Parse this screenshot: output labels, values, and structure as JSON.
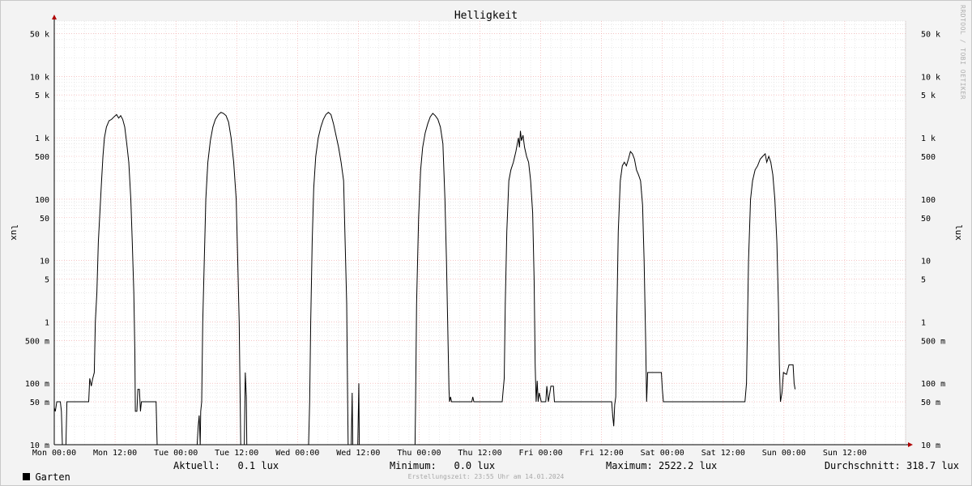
{
  "watermark": "RRDTOOL / TOBI OETIKER",
  "footer": "Erstellungszeit: 23:55 Uhr am 14.01.2024",
  "legend": {
    "series_name": "Garten",
    "current": "Aktuell:   0.1 lux",
    "minimum": "Minimum:   0.0 lux",
    "maximum": "Maximum: 2522.2 lux",
    "average": "Durchschnitt: 318.7 lux"
  },
  "colors": {
    "line": "#000000",
    "grid_minor": "#dcdcdc",
    "grid_major": "#f0a0a0",
    "axis": "#000000",
    "arrow": "#b00000",
    "canvas": "#ffffff",
    "background": "#f3f3f3"
  },
  "chart_data": {
    "type": "line",
    "title": "Helligkeit",
    "ylabel": "lux",
    "yscale": "log",
    "ylim": [
      10,
      100000
    ],
    "xlim": [
      0,
      168
    ],
    "x_unit": "hours since Mon 00:00",
    "x_ticks": [
      {
        "x": 0,
        "label": "Mon 00:00"
      },
      {
        "x": 12,
        "label": "Mon 12:00"
      },
      {
        "x": 24,
        "label": "Tue 00:00"
      },
      {
        "x": 36,
        "label": "Tue 12:00"
      },
      {
        "x": 48,
        "label": "Wed 00:00"
      },
      {
        "x": 60,
        "label": "Wed 12:00"
      },
      {
        "x": 72,
        "label": "Thu 00:00"
      },
      {
        "x": 84,
        "label": "Thu 12:00"
      },
      {
        "x": 96,
        "label": "Fri 00:00"
      },
      {
        "x": 108,
        "label": "Fri 12:00"
      },
      {
        "x": 120,
        "label": "Sat 00:00"
      },
      {
        "x": 132,
        "label": "Sat 12:00"
      },
      {
        "x": 144,
        "label": "Sun 00:00"
      },
      {
        "x": 156,
        "label": "Sun 12:00"
      }
    ],
    "y_ticks": [
      {
        "v": 10,
        "label": "10 m"
      },
      {
        "v": 50,
        "label": "50 m"
      },
      {
        "v": 100,
        "label": "100 m"
      },
      {
        "v": 500,
        "label": "500 m"
      },
      {
        "v": 1000,
        "label": "1"
      },
      {
        "v": 5000,
        "label": "5"
      },
      {
        "v": 10000,
        "label": "10"
      },
      {
        "v": 50000,
        "label": "50"
      },
      {
        "v": 100000,
        "label": "100"
      },
      {
        "v": 500000,
        "label": "500"
      },
      {
        "v": 1000000,
        "label": "1 k"
      },
      {
        "v": 5000000,
        "label": "5 k"
      },
      {
        "v": 10000000,
        "label": "10 k"
      },
      {
        "v": 50000000,
        "label": "50 k"
      }
    ],
    "y_tick_unit_note": "tick values in milli-lux",
    "series": [
      {
        "name": "Garten",
        "values": [
          [
            0,
            40
          ],
          [
            0.2,
            35
          ],
          [
            0.5,
            50
          ],
          [
            1.2,
            50
          ],
          [
            1.4,
            35
          ],
          [
            1.6,
            10
          ],
          [
            2.3,
            10
          ],
          [
            2.5,
            50
          ],
          [
            6.8,
            50
          ],
          [
            7.0,
            120
          ],
          [
            7.3,
            90
          ],
          [
            7.6,
            120
          ],
          [
            7.9,
            150
          ],
          [
            8.1,
            1000
          ],
          [
            8.4,
            3000
          ],
          [
            8.7,
            20000
          ],
          [
            9.0,
            60000
          ],
          [
            9.3,
            180000
          ],
          [
            9.6,
            500000
          ],
          [
            9.9,
            1000000
          ],
          [
            10.3,
            1500000
          ],
          [
            10.8,
            1900000
          ],
          [
            11.3,
            2000000
          ],
          [
            11.8,
            2200000
          ],
          [
            12.3,
            2400000
          ],
          [
            12.7,
            2100000
          ],
          [
            13.1,
            2300000
          ],
          [
            13.5,
            2000000
          ],
          [
            13.9,
            1500000
          ],
          [
            14.3,
            800000
          ],
          [
            14.7,
            400000
          ],
          [
            15.1,
            100000
          ],
          [
            15.4,
            20000
          ],
          [
            15.7,
            3000
          ],
          [
            15.9,
            300
          ],
          [
            16.0,
            35
          ],
          [
            16.3,
            35
          ],
          [
            16.5,
            80
          ],
          [
            16.8,
            80
          ],
          [
            17.0,
            35
          ],
          [
            17.2,
            50
          ],
          [
            20.1,
            50
          ],
          [
            20.3,
            10
          ],
          [
            28.2,
            10
          ],
          [
            28.4,
            20
          ],
          [
            28.6,
            30
          ],
          [
            28.8,
            10
          ],
          [
            28.9,
            35
          ],
          [
            29.1,
            50
          ],
          [
            29.3,
            1000
          ],
          [
            29.6,
            10000
          ],
          [
            29.9,
            100000
          ],
          [
            30.3,
            400000
          ],
          [
            30.8,
            900000
          ],
          [
            31.3,
            1500000
          ],
          [
            31.8,
            2000000
          ],
          [
            32.4,
            2400000
          ],
          [
            32.9,
            2600000
          ],
          [
            33.4,
            2500000
          ],
          [
            33.9,
            2300000
          ],
          [
            34.4,
            1800000
          ],
          [
            34.9,
            1000000
          ],
          [
            35.4,
            400000
          ],
          [
            35.9,
            100000
          ],
          [
            36.2,
            10000
          ],
          [
            36.5,
            1000
          ],
          [
            36.8,
            10
          ],
          [
            37.5,
            10
          ],
          [
            37.7,
            150
          ],
          [
            37.9,
            60
          ],
          [
            38.0,
            10
          ],
          [
            50.2,
            10
          ],
          [
            50.4,
            50
          ],
          [
            50.6,
            1000
          ],
          [
            50.9,
            20000
          ],
          [
            51.2,
            150000
          ],
          [
            51.6,
            500000
          ],
          [
            52.1,
            1000000
          ],
          [
            52.6,
            1500000
          ],
          [
            53.1,
            2000000
          ],
          [
            53.6,
            2400000
          ],
          [
            54.1,
            2600000
          ],
          [
            54.6,
            2400000
          ],
          [
            55.1,
            1700000
          ],
          [
            55.6,
            1100000
          ],
          [
            56.1,
            700000
          ],
          [
            56.6,
            400000
          ],
          [
            57.1,
            200000
          ],
          [
            57.4,
            20000
          ],
          [
            57.7,
            2000
          ],
          [
            57.9,
            50
          ],
          [
            58.0,
            10
          ],
          [
            58.6,
            10
          ],
          [
            58.8,
            70
          ],
          [
            58.9,
            10
          ],
          [
            59.9,
            10
          ],
          [
            60.1,
            100
          ],
          [
            60.2,
            10
          ],
          [
            71.2,
            10
          ],
          [
            71.3,
            40
          ],
          [
            71.5,
            2000
          ],
          [
            71.9,
            50000
          ],
          [
            72.3,
            300000
          ],
          [
            72.7,
            700000
          ],
          [
            73.2,
            1200000
          ],
          [
            73.7,
            1700000
          ],
          [
            74.2,
            2200000
          ],
          [
            74.7,
            2500000
          ],
          [
            75.2,
            2300000
          ],
          [
            75.7,
            2000000
          ],
          [
            76.2,
            1500000
          ],
          [
            76.7,
            800000
          ],
          [
            77.1,
            100000
          ],
          [
            77.4,
            10000
          ],
          [
            77.7,
            500
          ],
          [
            77.9,
            80
          ],
          [
            78.0,
            50
          ],
          [
            78.2,
            60
          ],
          [
            78.4,
            50
          ],
          [
            82.4,
            50
          ],
          [
            82.6,
            60
          ],
          [
            82.8,
            50
          ],
          [
            88.4,
            50
          ],
          [
            88.6,
            80
          ],
          [
            88.8,
            120
          ],
          [
            89.0,
            2000
          ],
          [
            89.3,
            30000
          ],
          [
            89.7,
            200000
          ],
          [
            90.1,
            300000
          ],
          [
            90.6,
            400000
          ],
          [
            91.1,
            600000
          ],
          [
            91.6,
            1000000
          ],
          [
            91.8,
            700000
          ],
          [
            92.0,
            1300000
          ],
          [
            92.2,
            900000
          ],
          [
            92.5,
            1100000
          ],
          [
            92.8,
            700000
          ],
          [
            93.2,
            500000
          ],
          [
            93.6,
            400000
          ],
          [
            94.0,
            200000
          ],
          [
            94.4,
            60000
          ],
          [
            94.7,
            5000
          ],
          [
            94.9,
            200
          ],
          [
            95.1,
            50
          ],
          [
            95.3,
            110
          ],
          [
            95.5,
            50
          ],
          [
            95.7,
            70
          ],
          [
            95.9,
            60
          ],
          [
            96.1,
            50
          ],
          [
            97.0,
            50
          ],
          [
            97.2,
            90
          ],
          [
            97.5,
            50
          ],
          [
            98.0,
            90
          ],
          [
            98.5,
            90
          ],
          [
            98.7,
            50
          ],
          [
            110.0,
            50
          ],
          [
            110.2,
            30
          ],
          [
            110.4,
            20
          ],
          [
            110.6,
            45
          ],
          [
            110.8,
            60
          ],
          [
            111.0,
            1000
          ],
          [
            111.3,
            30000
          ],
          [
            111.7,
            200000
          ],
          [
            112.1,
            350000
          ],
          [
            112.5,
            400000
          ],
          [
            112.9,
            350000
          ],
          [
            113.3,
            450000
          ],
          [
            113.7,
            600000
          ],
          [
            114.1,
            550000
          ],
          [
            114.5,
            450000
          ],
          [
            114.9,
            300000
          ],
          [
            115.3,
            250000
          ],
          [
            115.7,
            200000
          ],
          [
            116.1,
            80000
          ],
          [
            116.4,
            10000
          ],
          [
            116.7,
            500
          ],
          [
            116.9,
            50
          ],
          [
            117.1,
            150
          ],
          [
            119.8,
            150
          ],
          [
            120.0,
            80
          ],
          [
            120.2,
            50
          ],
          [
            124.1,
            50
          ],
          [
            124.3,
            50
          ],
          [
            124.4,
            50
          ],
          [
            136.3,
            50
          ],
          [
            136.6,
            100
          ],
          [
            137.0,
            10000
          ],
          [
            137.4,
            100000
          ],
          [
            137.8,
            200000
          ],
          [
            138.3,
            300000
          ],
          [
            138.8,
            350000
          ],
          [
            139.3,
            450000
          ],
          [
            139.8,
            500000
          ],
          [
            140.3,
            550000
          ],
          [
            140.6,
            400000
          ],
          [
            141.0,
            500000
          ],
          [
            141.4,
            400000
          ],
          [
            141.8,
            250000
          ],
          [
            142.2,
            100000
          ],
          [
            142.6,
            20000
          ],
          [
            142.9,
            2000
          ],
          [
            143.1,
            200
          ],
          [
            143.3,
            50
          ],
          [
            143.6,
            70
          ],
          [
            143.9,
            150
          ],
          [
            144.5,
            140
          ],
          [
            145.0,
            200
          ],
          [
            145.5,
            200
          ],
          [
            145.8,
            200
          ],
          [
            146.0,
            100
          ],
          [
            146.2,
            80
          ]
        ]
      }
    ]
  }
}
